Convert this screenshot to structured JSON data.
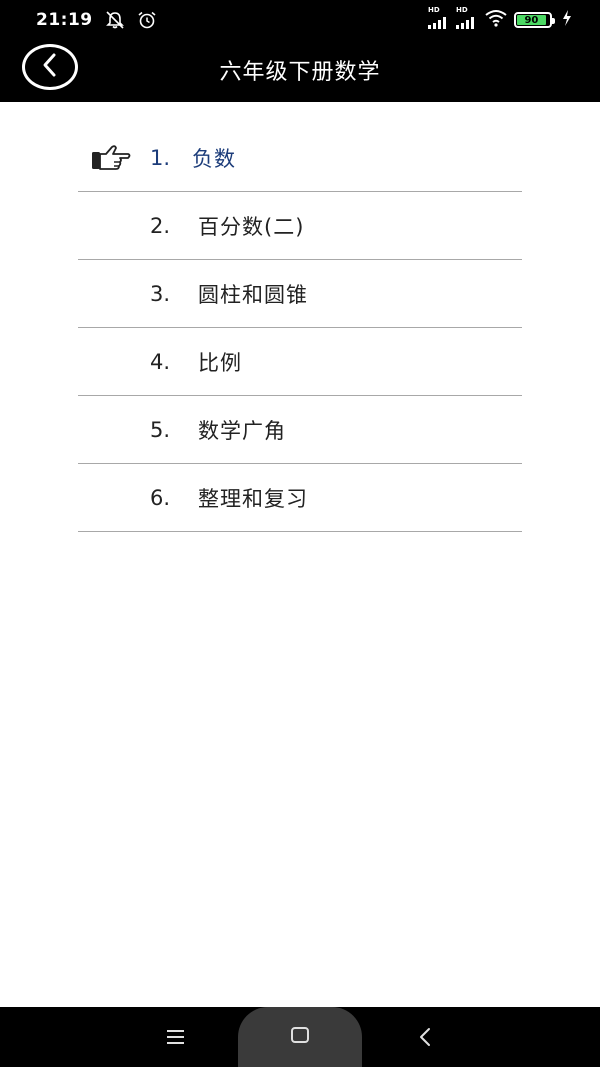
{
  "status": {
    "time": "21:19",
    "sim1_label": "HD",
    "sim2_label": "HD",
    "battery_text": "90",
    "battery_percent": 90,
    "icons": [
      "bell-off-icon",
      "alarm-icon",
      "signal-icon",
      "signal-icon",
      "wifi-icon",
      "battery-icon",
      "charging-icon"
    ]
  },
  "header": {
    "title": "六年级下册数学",
    "back_icon": "chevron-left-icon"
  },
  "chapters": [
    {
      "num": "1.",
      "label": "负数"
    },
    {
      "num": "2.",
      "label": "百分数(二)"
    },
    {
      "num": "3.",
      "label": "圆柱和圆锥"
    },
    {
      "num": "4.",
      "label": "比例"
    },
    {
      "num": "5.",
      "label": "数学广角"
    },
    {
      "num": "6.",
      "label": "整理和复习"
    }
  ],
  "selected_index": 0,
  "colors": {
    "bar_background": "#000000",
    "selected_text": "#1c3c7a",
    "normal_text": "#222222",
    "divider": "#a8a8a8"
  },
  "navbar": {
    "icons": [
      "menu-icon",
      "home-icon",
      "back-icon"
    ]
  }
}
